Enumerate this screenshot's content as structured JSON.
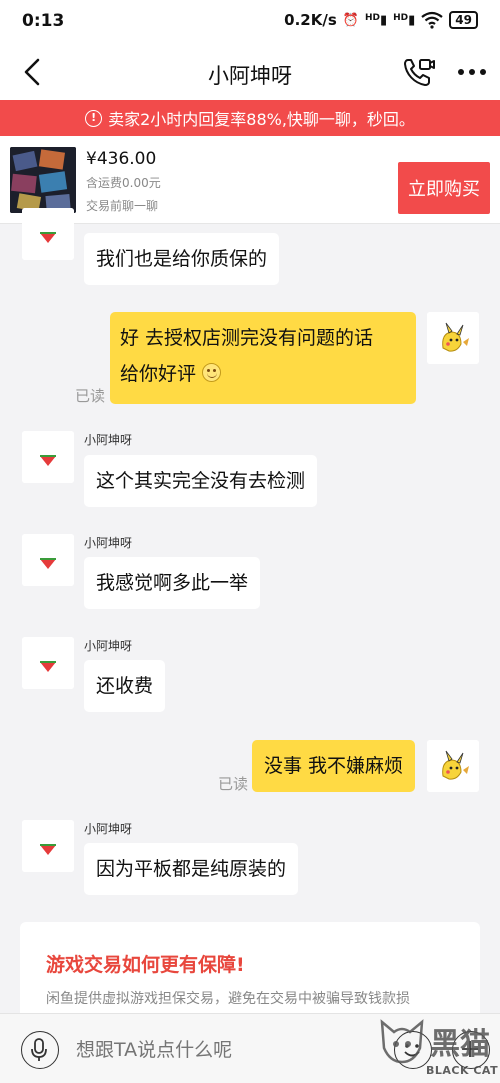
{
  "status_bar": {
    "time": "0:13",
    "network_speed": "0.2K/s",
    "signal_1": "HD",
    "signal_2": "HD",
    "battery": "49"
  },
  "header": {
    "title": "小阿坤呀",
    "back_icon": "chevron-left-icon",
    "call_icon": "phone-video-icon",
    "more_icon": "more-dots-icon"
  },
  "banner": {
    "text": "卖家2小时内回复率88%,快聊一聊，秒回。",
    "icon": "info-icon"
  },
  "product": {
    "price": "¥436.00",
    "shipping": "含运费0.00元",
    "tip": "交易前聊一聊",
    "buy_label": "立即购买"
  },
  "messages": [
    {
      "side": "left",
      "sender": "",
      "text": "我们也是给你质保的"
    },
    {
      "side": "right",
      "line1": "好 去授权店测完没有问题的话",
      "line2": "给你好评",
      "emoji": "smiley-icon",
      "status": "已读"
    },
    {
      "side": "left",
      "sender": "小阿坤呀",
      "text": "这个其实完全没有去检测"
    },
    {
      "side": "left",
      "sender": "小阿坤呀",
      "text": "我感觉啊多此一举"
    },
    {
      "side": "left",
      "sender": "小阿坤呀",
      "text": "还收费"
    },
    {
      "side": "right",
      "text": "没事 我不嫌麻烦",
      "status": "已读"
    },
    {
      "side": "left",
      "sender": "小阿坤呀",
      "text": "因为平板都是纯原装的"
    }
  ],
  "guarantee_card": {
    "title": "游戏交易如何更有保障!",
    "description": "闲鱼提供虚拟游戏担保交易，避免在交易中被骗导致钱款损"
  },
  "input_bar": {
    "placeholder": "想跟TA说点什么呢",
    "voice_icon": "microphone-icon",
    "emoji_icon": "emoji-icon",
    "plus_icon": "plus-icon"
  },
  "watermark": {
    "text": "BLACK CAT"
  },
  "colors": {
    "accent_red": "#f24b4b",
    "bubble_yellow": "#ffda44",
    "background": "#f3f3f5"
  }
}
